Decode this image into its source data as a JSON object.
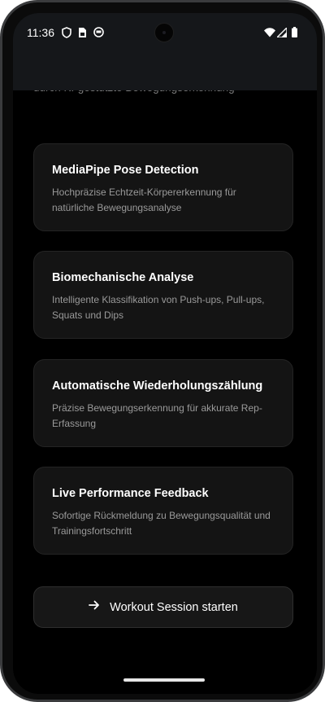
{
  "status_bar": {
    "time": "11:36"
  },
  "header": {
    "subtitle_partial": "durch KI-gestützte Bewegungserkennung"
  },
  "features": [
    {
      "title": "MediaPipe Pose Detection",
      "description": "Hochpräzise Echtzeit-Körpererkennung für natürliche Bewegungsanalyse"
    },
    {
      "title": "Biomechanische Analyse",
      "description": "Intelligente Klassifikation von Push-ups, Pull-ups, Squats und Dips"
    },
    {
      "title": "Automatische Wiederholungszählung",
      "description": "Präzise Bewegungserkennung für akkurate Rep-Erfassung"
    },
    {
      "title": "Live Performance Feedback",
      "description": "Sofortige Rückmeldung zu Bewegungsqualität und Trainingsfortschritt"
    }
  ],
  "cta": {
    "label": "Workout Session starten",
    "icon": "arrow-right-icon"
  },
  "colors": {
    "background": "#000000",
    "card_background": "#141414",
    "card_border": "#242424",
    "title_text": "#ffffff",
    "description_text": "#9a9a9a"
  }
}
